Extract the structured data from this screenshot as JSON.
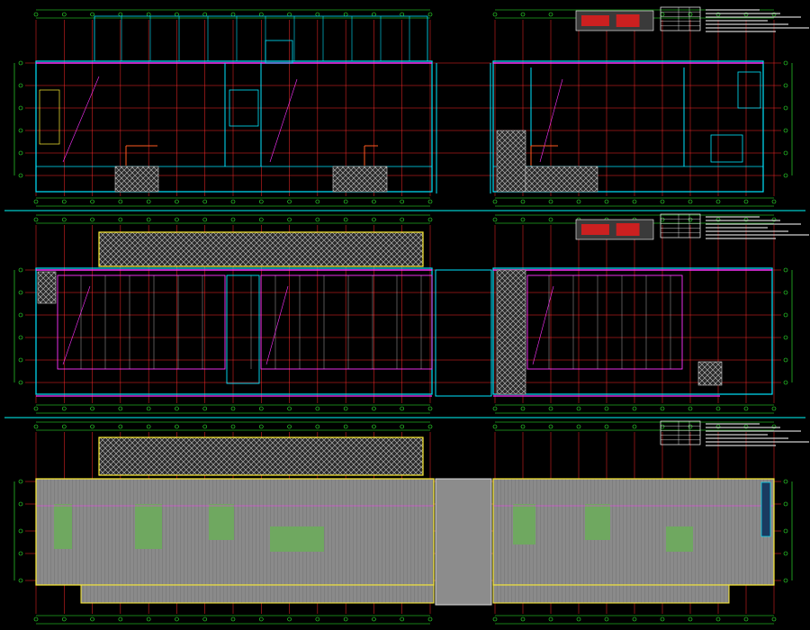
{
  "drawing": {
    "background": "#000000",
    "colors": {
      "grid": "#ff2a2a",
      "dims": "#33ff33",
      "walls": "#00e5ff",
      "partitions": "#ff33ff",
      "accent_yellow": "#ffee33",
      "leader_orange": "#ff5a1f",
      "separator": "#00c8c8",
      "roof_panel": "#8a8a8a",
      "roof_green": "#6fa860",
      "hatch": "#bdbdbd",
      "legend_frame": "#ffffff",
      "key_plan": "#cc2020"
    },
    "sheets": [
      {
        "id": "sheet-1",
        "kind": "floor-plan-ground"
      },
      {
        "id": "sheet-2",
        "kind": "floor-plan-upper"
      },
      {
        "id": "sheet-3",
        "kind": "roof-plan"
      }
    ]
  }
}
